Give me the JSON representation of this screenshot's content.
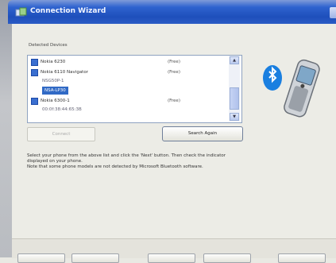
{
  "window": {
    "title": "Connection Wizard"
  },
  "devices_group": {
    "label": "Detected Devices",
    "rows": [
      {
        "name": "Nokia 6230",
        "status": "(Free)",
        "checked": true,
        "selected": false,
        "sub": false
      },
      {
        "name": "Nokia 6110 Navigator",
        "status": "(Free)",
        "checked": true,
        "selected": false,
        "sub": false
      },
      {
        "name": "NSG50P-1",
        "status": "",
        "checked": false,
        "selected": false,
        "sub": true
      },
      {
        "name": "NSA-LP30",
        "status": "",
        "checked": false,
        "selected": true,
        "sub": true
      },
      {
        "name": "Nokia 6300-1",
        "status": "(Free)",
        "checked": true,
        "selected": false,
        "sub": false
      },
      {
        "name": "00:0f:38:44:65:3B",
        "status": "",
        "checked": false,
        "selected": false,
        "sub": true
      }
    ]
  },
  "buttons": {
    "connect": "Connect",
    "search_again": "Search Again"
  },
  "instructions": {
    "line1": "Select your phone from the above list and click the 'Next' button. Then check the indicator",
    "line2": "displayed on your phone.",
    "line3": "Note that some phone models are not detected by Microsoft Bluetooth software."
  },
  "colors": {
    "titlebar": "#2f63cf",
    "selection": "#316ac5",
    "bluetooth": "#1a7fe0"
  }
}
